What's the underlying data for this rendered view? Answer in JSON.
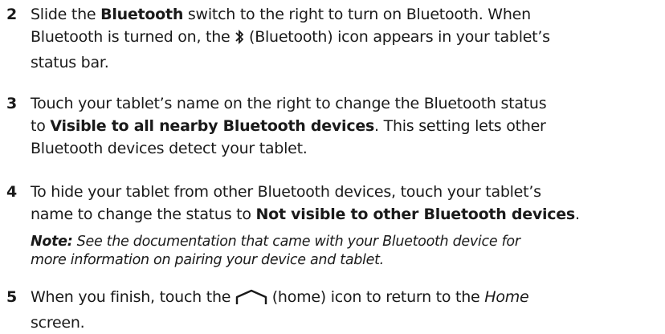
{
  "steps": [
    {
      "number": "2",
      "line1_a": "Slide the ",
      "line1_b": "Bluetooth",
      "line1_c": " switch to the right to turn on Bluetooth. When",
      "line2_a": "Bluetooth is turned on, the ",
      "line2_b": " (Bluetooth) icon appears in your tablet’s",
      "line3": "status bar."
    },
    {
      "number": "3",
      "line1": "Touch your tablet’s name on the right to change the Bluetooth status",
      "line2_a": "to ",
      "line2_b": "Visible to all nearby Bluetooth devices",
      "line2_c": ". This setting lets other",
      "line3": "Bluetooth devices detect your tablet."
    },
    {
      "number": "4",
      "line1": "To hide your tablet from other Bluetooth devices, touch your tablet’s",
      "line2_a": "name to change the status to ",
      "line2_b": "Not visible to other Bluetooth devices",
      "line2_c": ".",
      "note_label": "Note:",
      "note_line1": " See the documentation that came with your Bluetooth device for",
      "note_line2": "more information on pairing your device and tablet."
    },
    {
      "number": "5",
      "line1_a": "When you finish, touch the ",
      "line1_b": " (home) icon to return to the ",
      "line1_c": "Home",
      "line2": "screen."
    }
  ],
  "icons": {
    "bluetooth": "bluetooth-icon",
    "home": "home-icon"
  }
}
